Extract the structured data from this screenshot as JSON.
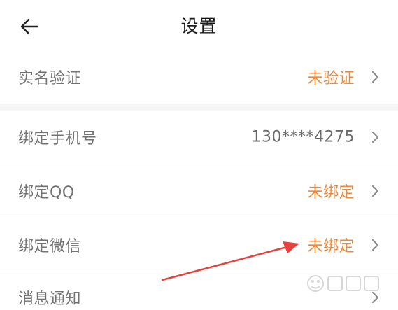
{
  "header": {
    "title": "设置",
    "back_icon": "arrow-left-icon"
  },
  "rows": [
    {
      "label": "实名验证",
      "value": "未验证",
      "value_color": "#f0883a"
    },
    {
      "label": "绑定手机号",
      "value": "130****4275",
      "value_color": "#6a6a6a"
    },
    {
      "label": "绑定QQ",
      "value": "未绑定",
      "value_color": "#f0883a"
    },
    {
      "label": "绑定微信",
      "value": "未绑定",
      "value_color": "#f0883a"
    },
    {
      "label": "消息通知",
      "value": "",
      "value_color": ""
    }
  ],
  "icons": {
    "row_chevron": "chevron-right-icon"
  },
  "colors": {
    "accent_orange": "#f0883a",
    "annotation_red": "#e8403a",
    "section_gap": "#f6f6f6"
  }
}
